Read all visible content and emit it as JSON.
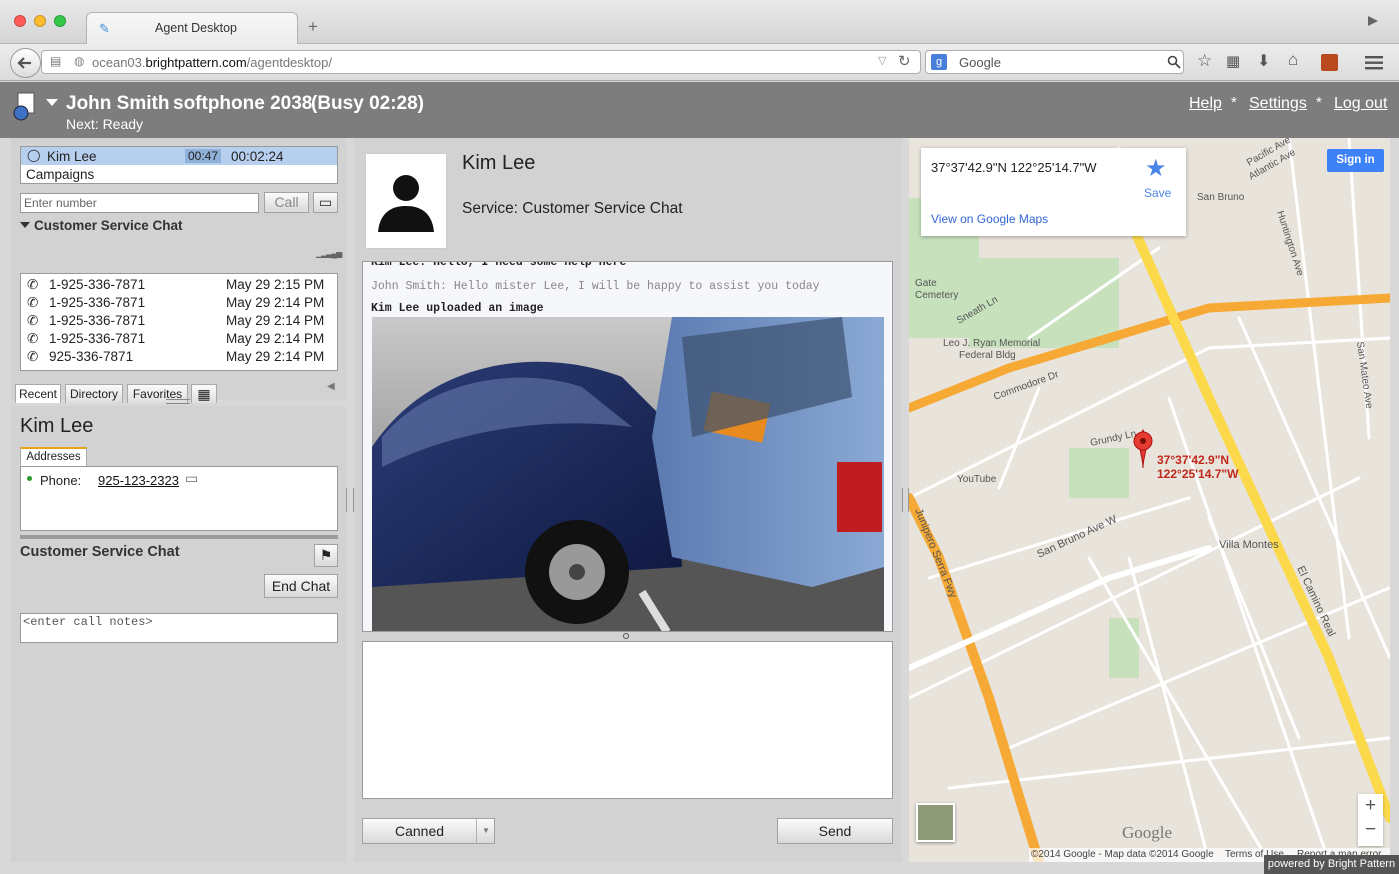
{
  "browser": {
    "tab_title": "Agent Desktop",
    "url_host": "ocean03.",
    "url_domain": "brightpattern.com",
    "url_path": "/agentdesktop/",
    "search_placeholder": "Google"
  },
  "header": {
    "agent_name": "John Smith",
    "phone": "softphone 2038",
    "status": "(Busy 02:28)",
    "next": "Next: Ready",
    "links": {
      "help": "Help",
      "settings": "Settings",
      "logout": "Log out"
    },
    "separator": "*"
  },
  "active_call": {
    "name": "Kim Lee",
    "timer1": "00:47",
    "timer2": "00:02:24",
    "campaigns": "Campaigns",
    "number_placeholder": "Enter number",
    "call_btn": "Call",
    "service_label": "Customer Service Chat"
  },
  "tabs": {
    "recent": "Recent",
    "directory": "Directory",
    "favorites": "Favorites"
  },
  "recent": [
    {
      "number": "1-925-336-7871",
      "time": "May 29 2:15 PM"
    },
    {
      "number": "1-925-336-7871",
      "time": "May 29 2:14 PM"
    },
    {
      "number": "1-925-336-7871",
      "time": "May 29 2:14 PM"
    },
    {
      "number": "1-925-336-7871",
      "time": "May 29 2:14 PM"
    },
    {
      "number": "925-336-7871",
      "time": "May 29 2:14 PM"
    }
  ],
  "contact": {
    "name": "Kim Lee",
    "addresses_tab": "Addresses",
    "phone_label": "Phone:",
    "phone_value": "925-123-2323",
    "service": "Customer Service Chat",
    "end_chat": "End Chat",
    "notes_placeholder": "<enter call notes>"
  },
  "chat": {
    "name": "Kim Lee",
    "service": "Service: Customer Service Chat",
    "messages": [
      "Kim Lee: Hello, I need some help here",
      "John Smith: Hello mister Lee, I will be happy to assist you today",
      "Kim Lee uploaded an image"
    ],
    "canned": "Canned",
    "send": "Send"
  },
  "map": {
    "coords": "37°37'42.9\"N 122°25'14.7\"W",
    "save": "Save",
    "view_link": "View on Google Maps",
    "signin": "Sign in",
    "pin_lat": "37°37'42.9\"N",
    "pin_lng": "122°25'14.7\"W",
    "attribution": "©2014 Google - Map data ©2014 Google",
    "terms": "Terms of Use",
    "report": "Report a map error",
    "logo": "Google",
    "powered": "powered by Bright Pattern",
    "zoom_in": "+",
    "zoom_out": "−",
    "labels": {
      "san_bruno": "San Bruno",
      "gate_cemetery": "Gate\nCemetery",
      "sneath": "Sneath Ln",
      "ryan": "Leo J. Ryan Memorial\nFederal Bldg",
      "commodore": "Commodore Dr",
      "grundy": "Grundy Ln",
      "youtube": "YouTube",
      "san_bruno_ave": "San Bruno Ave W",
      "villa_montes": "Villa Montes",
      "el_camino": "El Camino Real",
      "junipero": "Junipero Serra Fwy",
      "huntington": "Huntington Ave",
      "san_mateo": "San Mateo Ave",
      "pacific": "Pacific Ave",
      "atlantic": "Atlantic Ave"
    }
  },
  "colors": {
    "accent": "#1a73e8",
    "header_bg": "#7d7d7d",
    "selected": "#b7cfee"
  }
}
